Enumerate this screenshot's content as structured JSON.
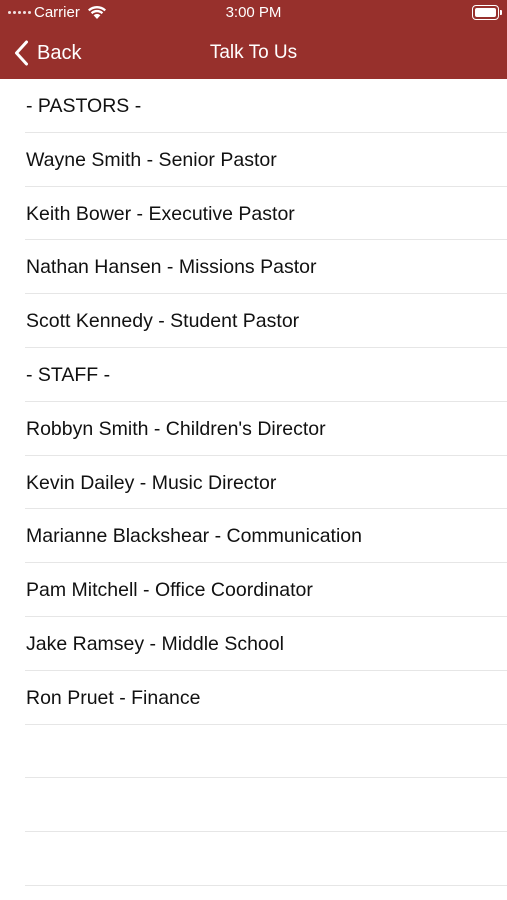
{
  "status_bar": {
    "carrier": "Carrier",
    "time": "3:00 PM",
    "signal_icon": "signal-dots-icon",
    "wifi_icon": "wifi-icon",
    "battery_icon": "battery-icon",
    "battery_level": 0.9
  },
  "nav": {
    "back_label": "Back",
    "back_icon": "chevron-left-icon",
    "title": "Talk To Us",
    "accent_color": "#97302c"
  },
  "list": {
    "items": [
      {
        "label": "- PASTORS -"
      },
      {
        "label": "Wayne Smith - Senior Pastor"
      },
      {
        "label": "Keith Bower - Executive Pastor"
      },
      {
        "label": "Nathan Hansen - Missions Pastor"
      },
      {
        "label": "Scott Kennedy - Student Pastor"
      },
      {
        "label": "- STAFF -"
      },
      {
        "label": "Robbyn Smith - Children's Director"
      },
      {
        "label": "Kevin Dailey - Music Director"
      },
      {
        "label": "Marianne Blackshear - Communication"
      },
      {
        "label": "Pam Mitchell - Office Coordinator"
      },
      {
        "label": "Jake Ramsey - Middle School"
      },
      {
        "label": "Ron Pruet - Finance"
      }
    ]
  }
}
